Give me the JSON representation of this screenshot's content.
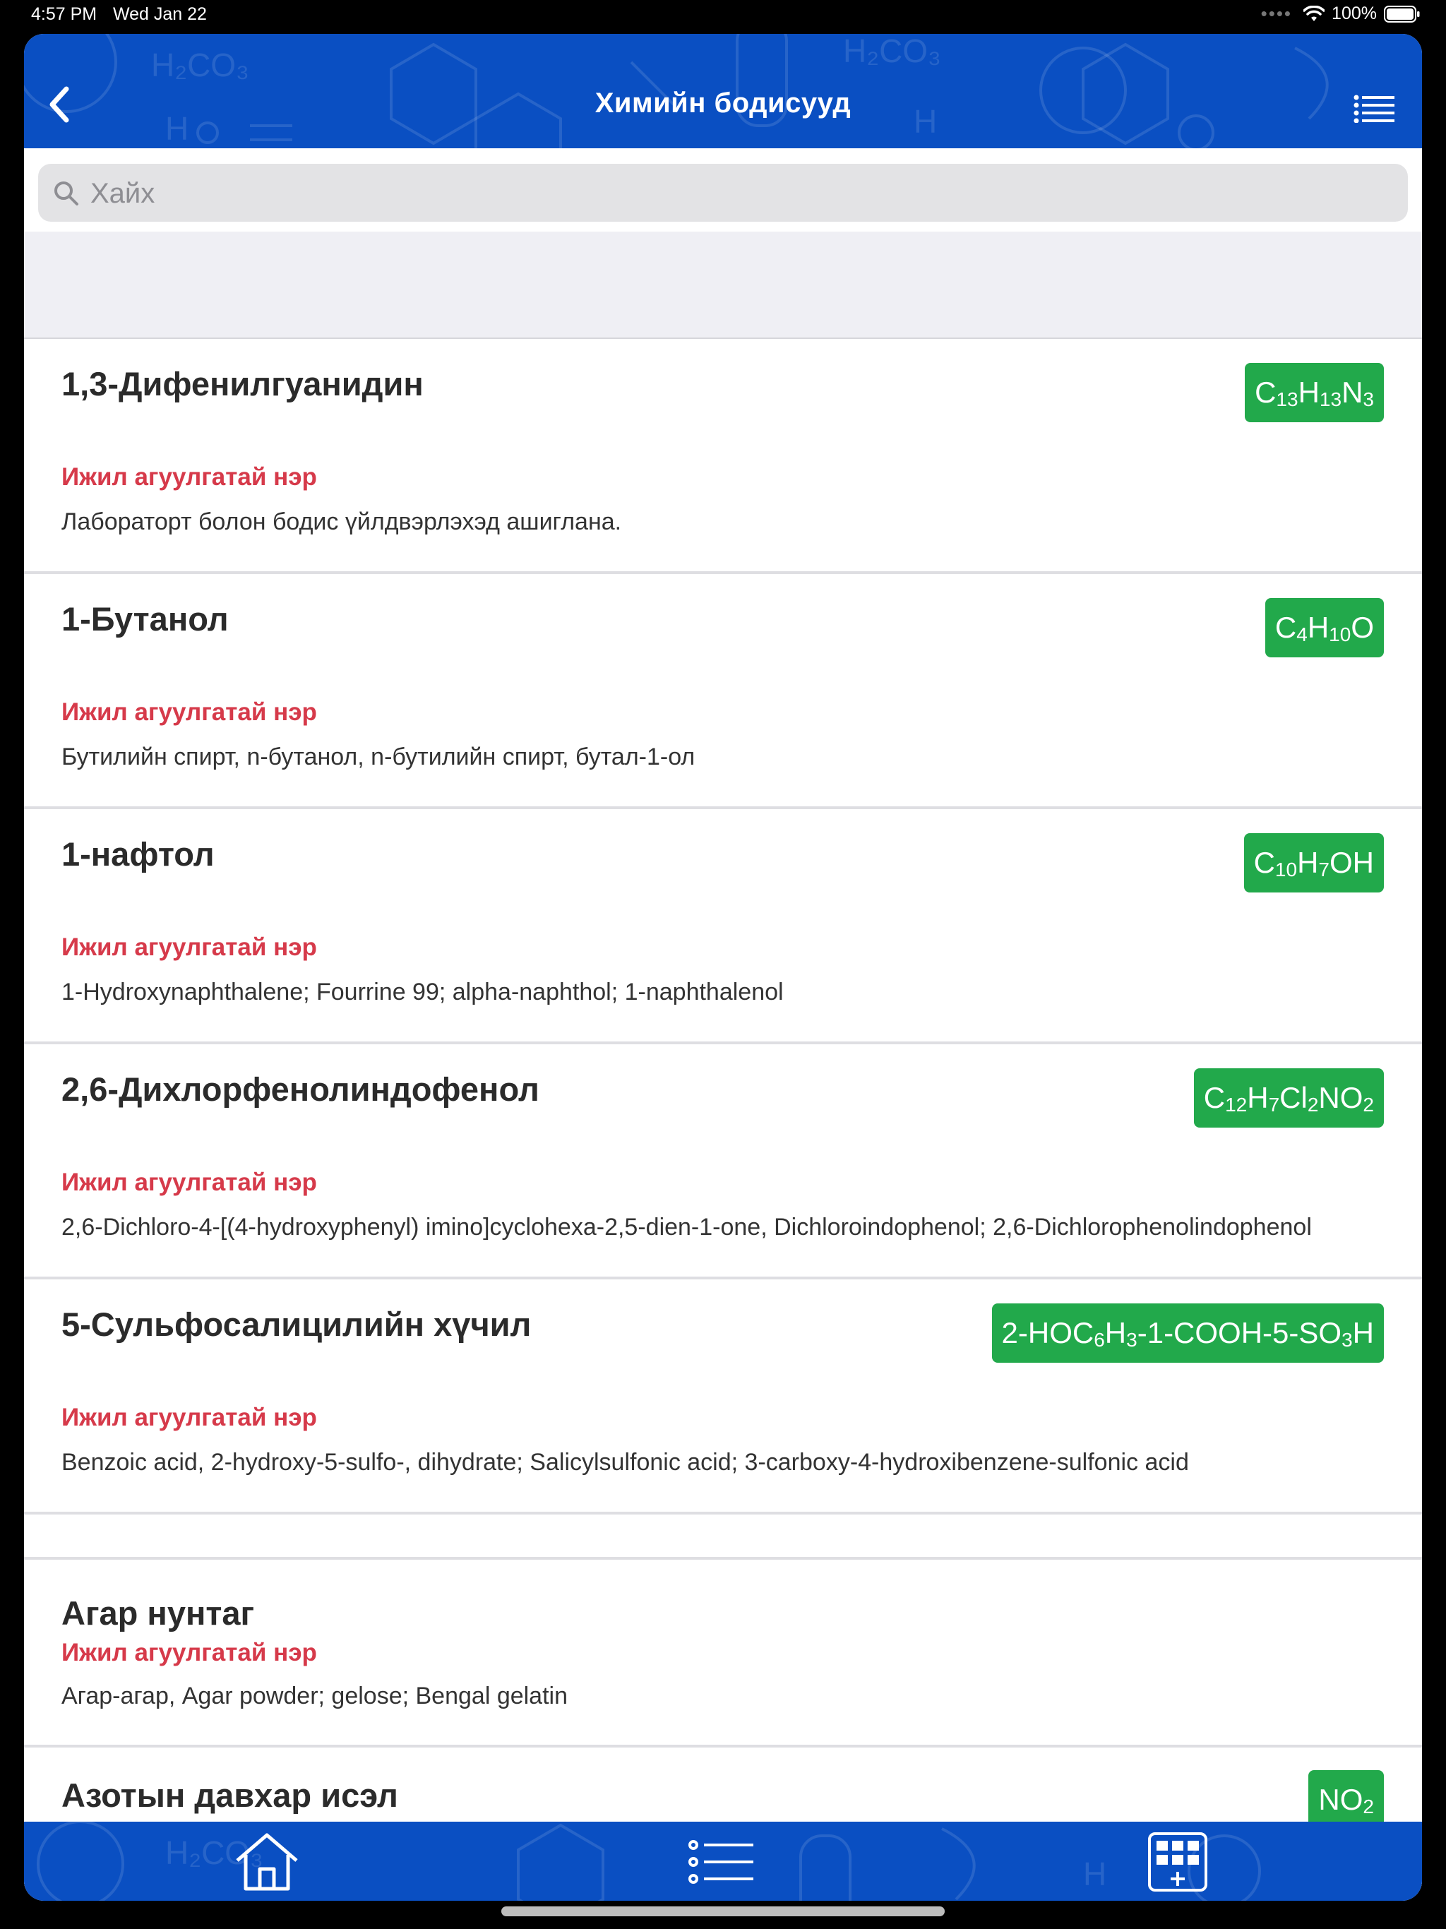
{
  "status": {
    "time": "4:57 PM",
    "date": "Wed Jan 22",
    "battery": "100%"
  },
  "header": {
    "title": "Химийн бодисууд"
  },
  "search": {
    "placeholder": "Хайх",
    "value": ""
  },
  "items": [
    {
      "name": "1,3-Дифенилгуанидин",
      "formula": [
        "C",
        "13",
        "H",
        "13",
        "N",
        "3"
      ],
      "synonym_label": "Ижил агуулгатай нэр",
      "synonyms": "Лабораторт болон бодис үйлдвэрлэхэд ашиглана."
    },
    {
      "name": "1-Бутанол",
      "formula": [
        "C",
        "4",
        "H",
        "10",
        "O",
        ""
      ],
      "synonym_label": "Ижил агуулгатай нэр",
      "synonyms": "Бутилийн спирт, n-бутанол, n-бутилийн спирт, бутал-1-ол"
    },
    {
      "name": "1-нафтол",
      "formula": [
        "C",
        "10",
        "H",
        "7",
        "OH",
        ""
      ],
      "synonym_label": "Ижил агуулгатай нэр",
      "synonyms": "1-Hydroxynaphthalene; Fourrine 99; alpha-naphthol; 1-naphthalenol"
    },
    {
      "name": "2,6-Дихлорфенолиндофенол",
      "formula": [
        "C",
        "12",
        "H",
        "7",
        "Cl",
        "2",
        "NO",
        "2"
      ],
      "synonym_label": "Ижил агуулгатай нэр",
      "synonyms": "2,6-Dichloro-4-[(4-hydroxyphenyl) imino]cyclohexa-2,5-dien-1-one, Dichloroindophenol; 2,6-Dichlorophenolindophenol"
    },
    {
      "name": "5-Сульфосалицилийн хүчил",
      "formula": [
        "2-HOC",
        "6",
        "H",
        "3",
        "-1-COOH-5-SO",
        "3",
        "H",
        ""
      ],
      "synonym_label": "Ижил агуулгатай нэр",
      "synonyms": "Benzoic acid, 2-hydroxy-5-sulfo-, dihydrate; Salicylsulfonic acid; 3-carboxy-4-hydroxibenzene-sulfonic acid"
    },
    {
      "name": "Агар нунтаг",
      "synonym_label": "Ижил агуулгатай нэр",
      "synonyms": "Агар-агар, Agar powder; gelose; Bengal gelatin"
    },
    {
      "name": "Азотын давхар исэл",
      "formula": [
        "NO",
        "2"
      ]
    }
  ],
  "colors": {
    "nav_blue": "#0a4fc2",
    "formula_green": "#22a94b",
    "synonym_red": "#d63a4a"
  },
  "icons": {
    "back": "chevron-left-icon",
    "menu": "list-menu-icon",
    "search": "search-icon",
    "home": "home-icon",
    "list": "bullet-list-icon",
    "grid": "periodic-grid-add-icon"
  }
}
